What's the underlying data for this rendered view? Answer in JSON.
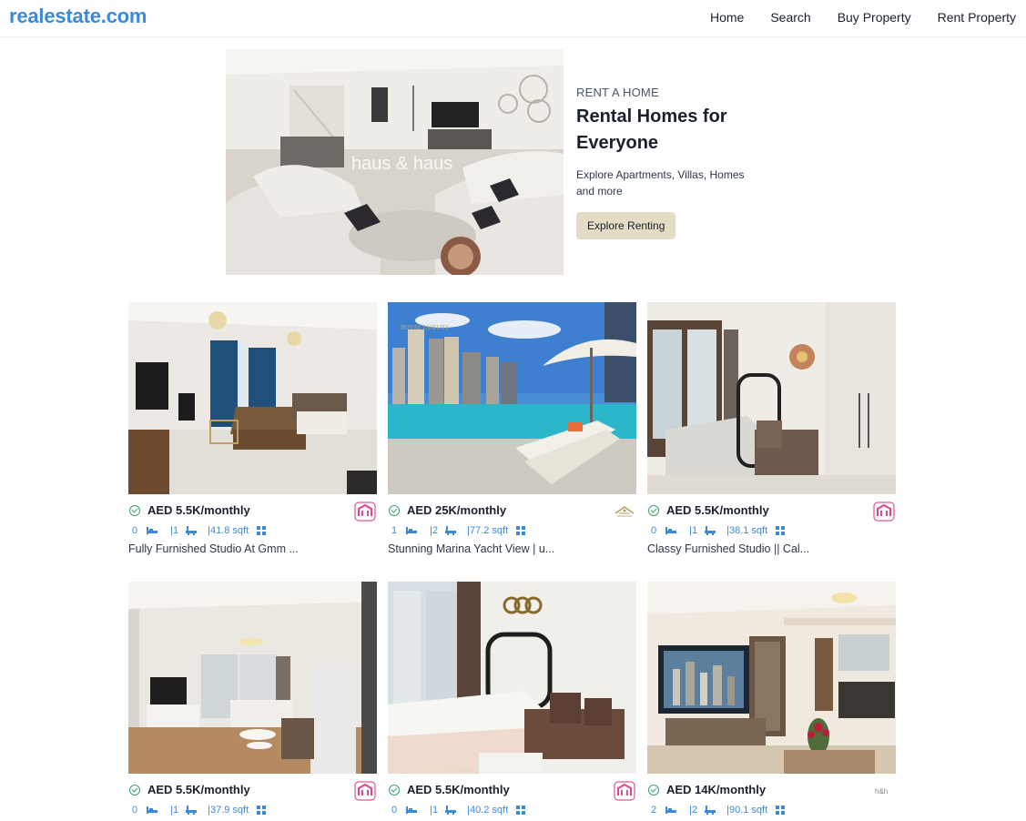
{
  "brand": {
    "logo": "realestate.com"
  },
  "nav": {
    "links": [
      {
        "label": "Home"
      },
      {
        "label": "Search"
      },
      {
        "label": "Buy Property"
      },
      {
        "label": "Rent Property"
      }
    ]
  },
  "hero": {
    "purpose": "RENT A HOME",
    "title_line1": "Rental Homes for",
    "title_line2": "Everyone",
    "desc_line1": "Explore Apartments, Villas, Homes",
    "desc_line2": "and more",
    "button": "Explore Renting",
    "watermark": "haus & haus"
  },
  "properties": [
    {
      "price": "AED 5.5K/monthly",
      "rooms": "0",
      "baths": "|1",
      "area": "|41.8 sqft",
      "title": "Fully Furnished Studio At Gmm ...",
      "agency": "peaceful"
    },
    {
      "price": "AED 25K/monthly",
      "rooms": "1",
      "baths": "|2",
      "area": "|77.2 sqft",
      "title": "Stunning Marina Yacht View | u...",
      "agency": "royal-luxury"
    },
    {
      "price": "AED 5.5K/monthly",
      "rooms": "0",
      "baths": "|1",
      "area": "|38.1 sqft",
      "title": "Classy Furnished Studio || Cal...",
      "agency": "peaceful"
    },
    {
      "price": "AED 5.5K/monthly",
      "rooms": "0",
      "baths": "|1",
      "area": "|37.9 sqft",
      "title": "",
      "agency": "peaceful"
    },
    {
      "price": "AED 5.5K/monthly",
      "rooms": "0",
      "baths": "|1",
      "area": "|40.2 sqft",
      "title": "",
      "agency": "peaceful"
    },
    {
      "price": "AED 14K/monthly",
      "rooms": "2",
      "baths": "|2",
      "area": "|90.1 sqft",
      "title": "",
      "agency": "haus-haus"
    }
  ],
  "colors": {
    "brand": "#3b8ad9",
    "verified": "#38a169",
    "button": "#e4dcc3"
  }
}
